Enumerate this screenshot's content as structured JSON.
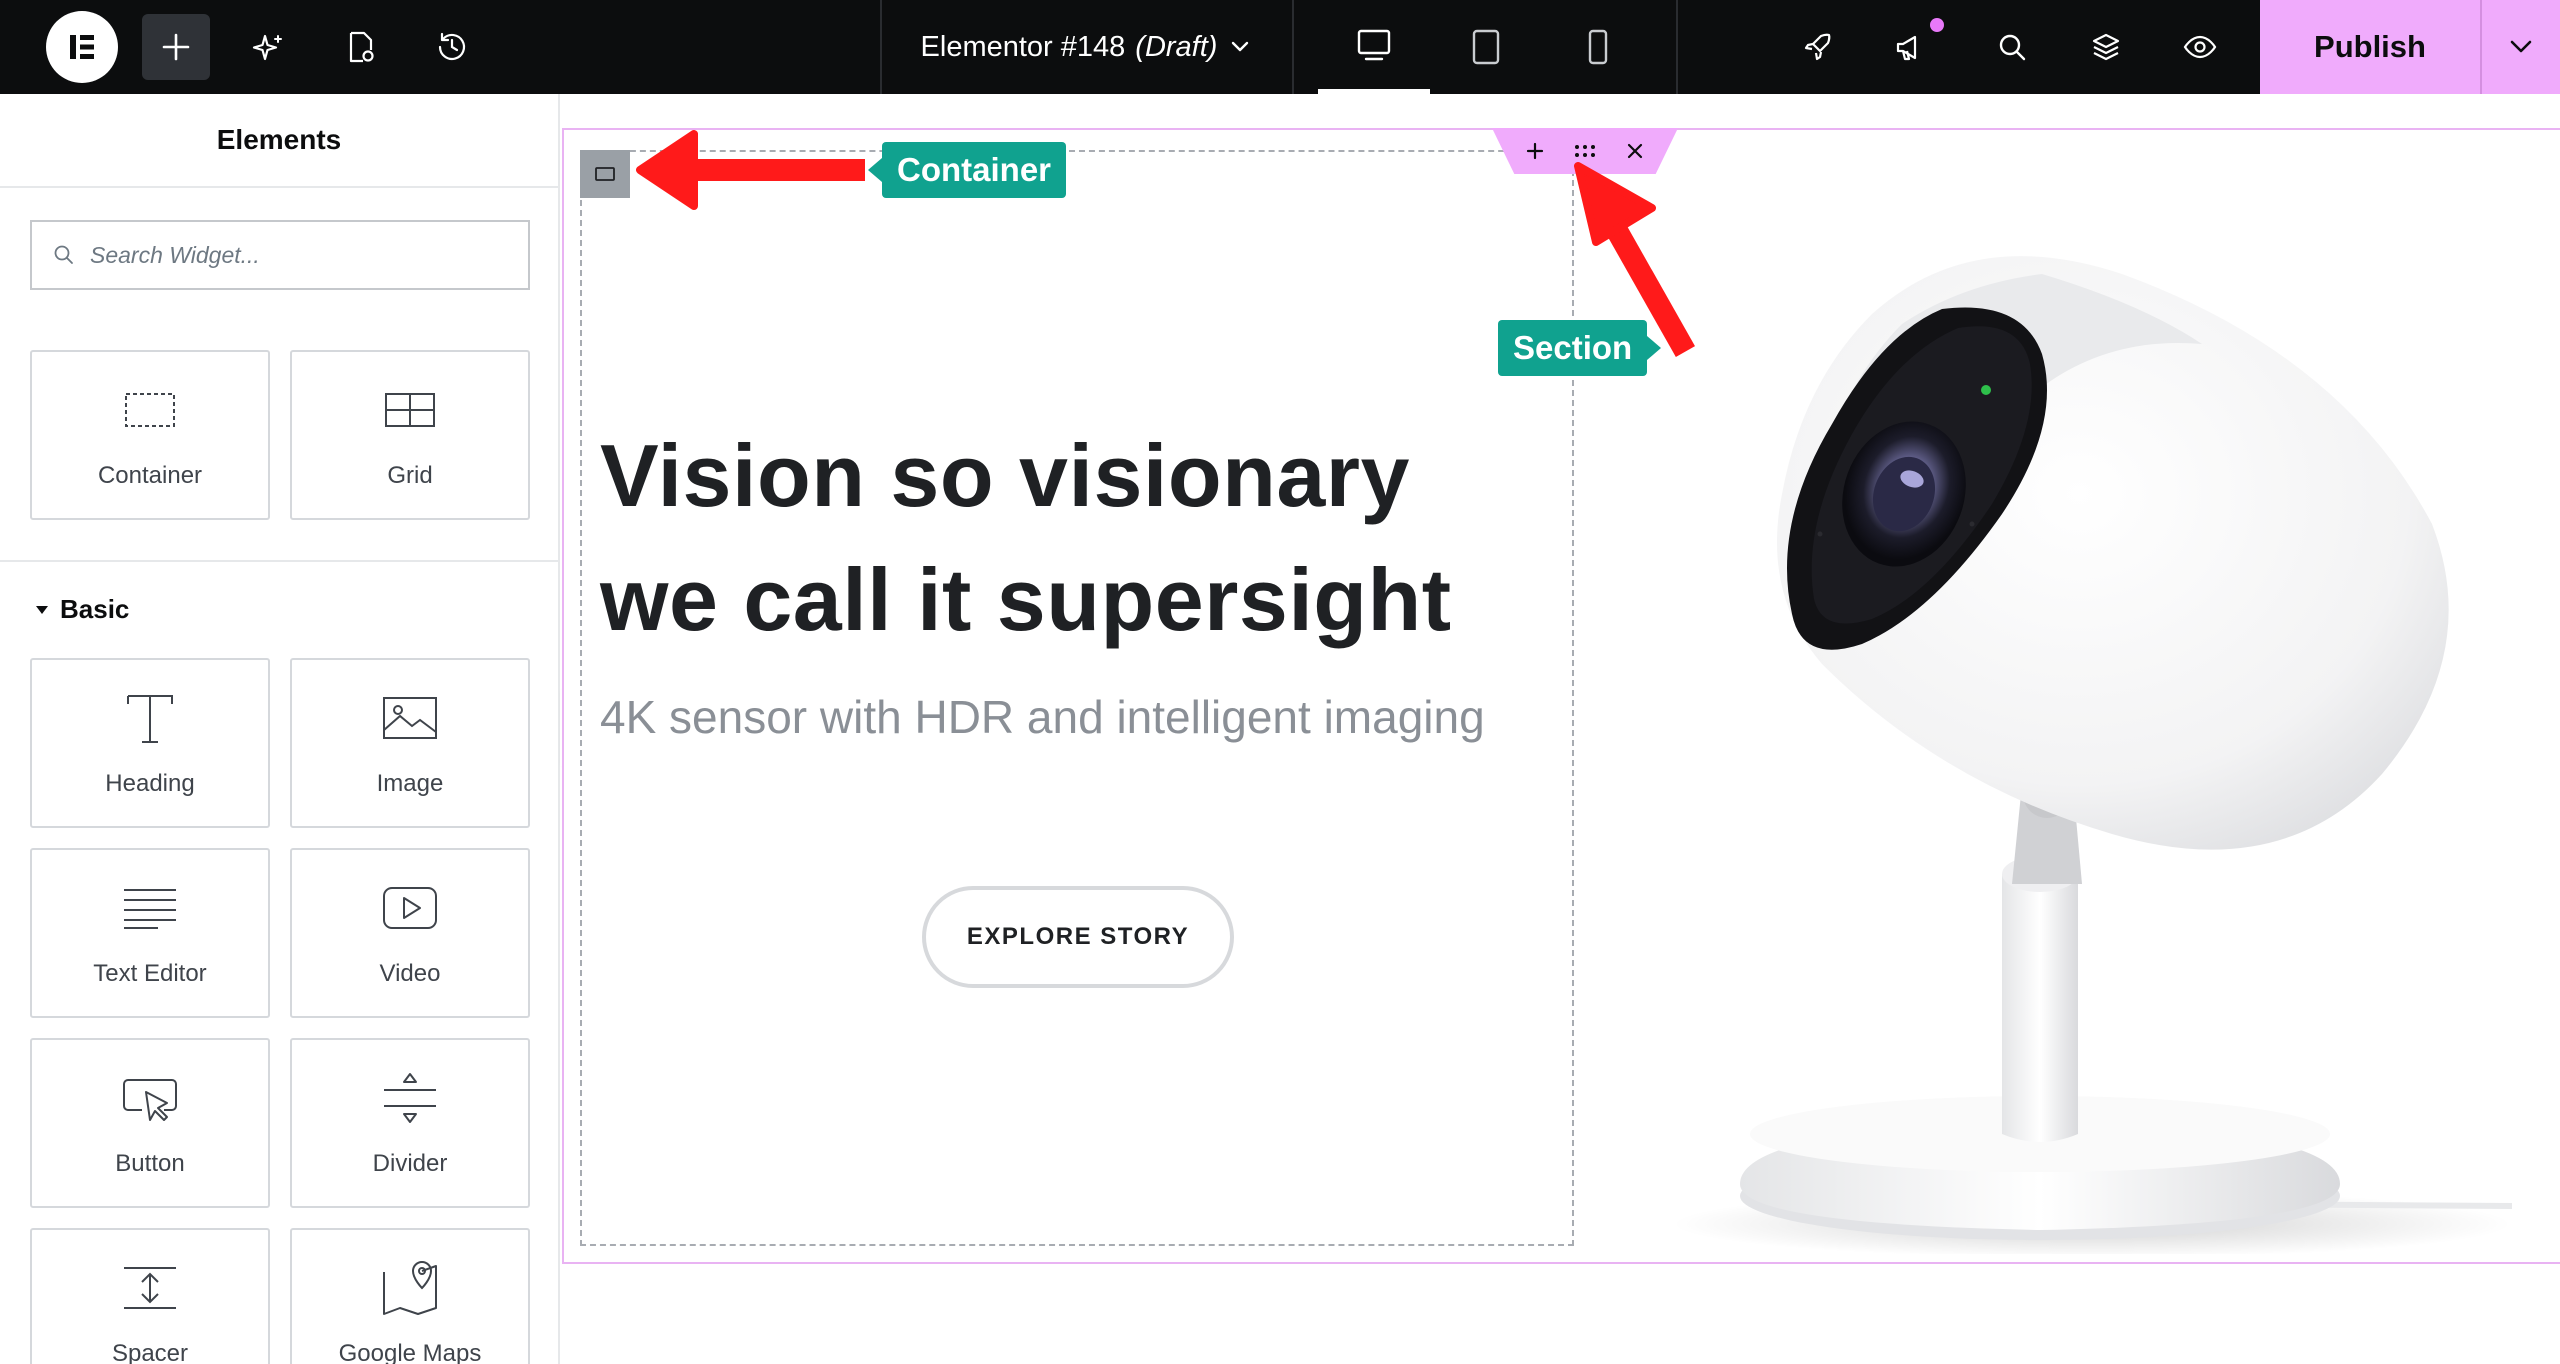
{
  "topbar": {
    "doc_name": "Elementor #148",
    "doc_status": "(Draft)",
    "publish_label": "Publish"
  },
  "panel": {
    "title": "Elements",
    "search_placeholder": "Search Widget...",
    "layout_items": [
      {
        "label": "Container",
        "icon": "container-icon"
      },
      {
        "label": "Grid",
        "icon": "grid-icon"
      }
    ],
    "basic_section": "Basic",
    "basic_items": [
      {
        "label": "Heading",
        "icon": "heading-icon"
      },
      {
        "label": "Image",
        "icon": "image-icon"
      },
      {
        "label": "Text Editor",
        "icon": "text-editor-icon"
      },
      {
        "label": "Video",
        "icon": "video-icon"
      },
      {
        "label": "Button",
        "icon": "button-icon"
      },
      {
        "label": "Divider",
        "icon": "divider-icon"
      },
      {
        "label": "Spacer",
        "icon": "spacer-icon"
      },
      {
        "label": "Google Maps",
        "icon": "map-icon"
      }
    ]
  },
  "canvas": {
    "hero_title": "Vision so visionary we call it supersight",
    "hero_subtitle": "4K sensor with HDR and intelligent imaging",
    "cta_label": "EXPLORE STORY"
  },
  "annotations": {
    "container_label": "Container",
    "section_label": "Section"
  },
  "colors": {
    "accent": "#f0abfc",
    "callout": "#10a28f",
    "arrow": "#ff0000",
    "topbar_bg": "#0c0d0e"
  }
}
